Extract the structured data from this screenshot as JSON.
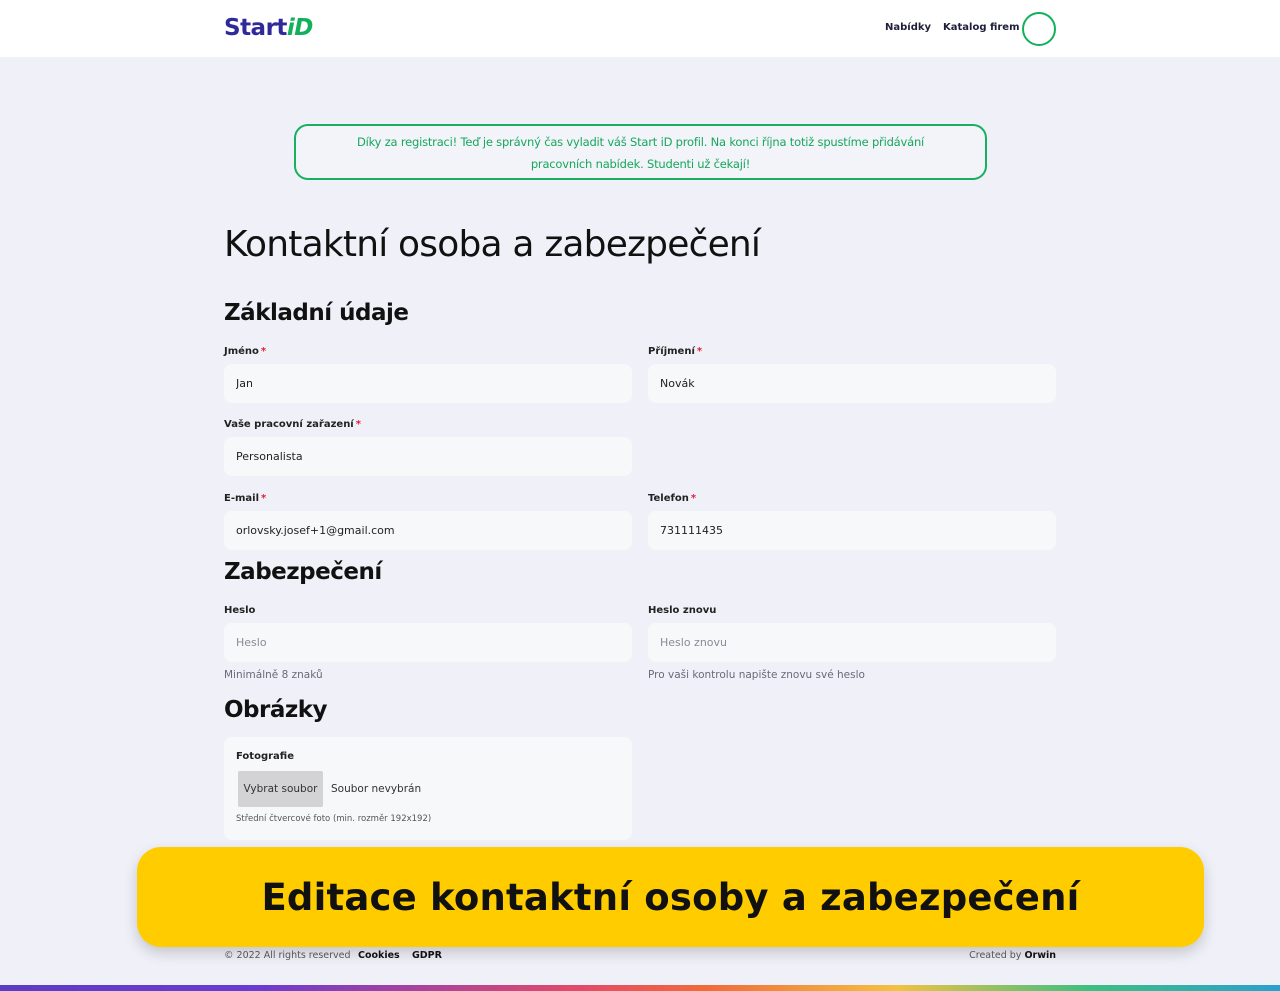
{
  "header": {
    "logo_main": "Start",
    "logo_accent": "iD",
    "nav_offers": "Nabídky",
    "nav_catalog": "Katalog firem"
  },
  "notice": {
    "text": "Díky za registraci! Teď je správný čas vyladit váš Start iD profil. Na konci října totiž spustíme přidávání pracovních nabídek. Studenti už čekají!"
  },
  "page": {
    "title": "Kontaktní osoba a zabezpečení"
  },
  "basic": {
    "section_title": "Základní údaje",
    "first_name_label": "Jméno",
    "first_name_value": "Jan",
    "last_name_label": "Příjmení",
    "last_name_value": "Novák",
    "position_label": "Vaše pracovní zařazení",
    "position_value": "Personalista",
    "email_label": "E-mail",
    "email_value": "orlovsky.josef+1@gmail.com",
    "phone_label": "Telefon",
    "phone_value": "731111435",
    "required_mark": "*"
  },
  "security": {
    "section_title": "Zabezpečení",
    "password_label": "Heslo",
    "password_placeholder": "Heslo",
    "password_hint": "Minimálně 8 znaků",
    "password_again_label": "Heslo znovu",
    "password_again_placeholder": "Heslo znovu",
    "password_again_hint": "Pro vaši kontrolu napište znovu své heslo"
  },
  "images": {
    "section_title": "Obrázky",
    "photo_label": "Fotografie",
    "file_button": "Vybrat soubor",
    "file_status": "Soubor nevybrán",
    "photo_hint": "Střední čtvercové foto (min. rozměr 192x192)"
  },
  "banner": {
    "text": "Editace kontaktní osoby a zabezpečení"
  },
  "footer": {
    "copyright": "© 2022 All rights reserved",
    "cookies": "Cookies",
    "gdpr": "GDPR",
    "created_by": "Created by",
    "author": "Orwin"
  },
  "colors": {
    "brand_blue": "#2f2a9a",
    "brand_green": "#12b05a",
    "banner_yellow": "#ffcc00",
    "required_red": "#e0203a"
  }
}
